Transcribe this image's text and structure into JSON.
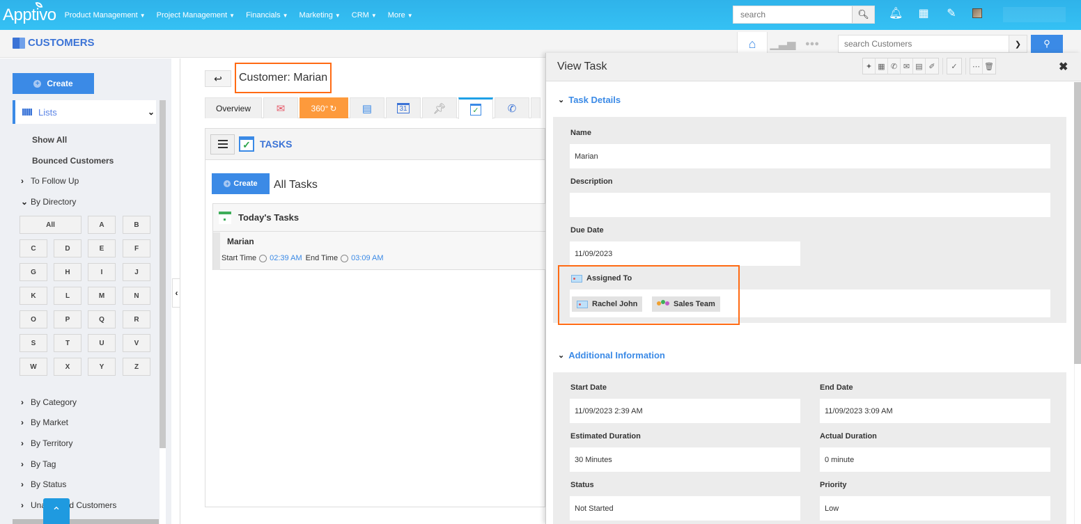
{
  "topbar": {
    "logo": "Apptivo",
    "menu": [
      {
        "label": "Product Management"
      },
      {
        "label": "Project Management"
      },
      {
        "label": "Financials"
      },
      {
        "label": "Marketing"
      },
      {
        "label": "CRM"
      },
      {
        "label": "More"
      }
    ],
    "search_placeholder": "search",
    "icons": [
      "bell-icon",
      "store-icon",
      "notes-icon",
      "avatar"
    ]
  },
  "subheader": {
    "app_title": "CUSTOMERS",
    "search_placeholder": "search Customers"
  },
  "sidebar": {
    "create_label": "Create",
    "lists_label": "Lists",
    "items": [
      {
        "label": "Show All",
        "type": "plain"
      },
      {
        "label": "Bounced Customers",
        "type": "plain"
      },
      {
        "label": "To Follow Up",
        "type": "collapsed"
      },
      {
        "label": "By Directory",
        "type": "expanded"
      },
      {
        "label": "By Category",
        "type": "collapsed"
      },
      {
        "label": "By Market",
        "type": "collapsed"
      },
      {
        "label": "By Territory",
        "type": "collapsed"
      },
      {
        "label": "By Tag",
        "type": "collapsed"
      },
      {
        "label": "By Status",
        "type": "collapsed"
      },
      {
        "label": "Unattended Customers",
        "type": "collapsed"
      }
    ],
    "directory": [
      "All",
      "A",
      "B",
      "C",
      "D",
      "E",
      "F",
      "G",
      "H",
      "I",
      "J",
      "K",
      "L",
      "M",
      "N",
      "O",
      "P",
      "Q",
      "R",
      "S",
      "T",
      "U",
      "V",
      "W",
      "X",
      "Y",
      "Z"
    ]
  },
  "main": {
    "customer_title": "Customer: Marian",
    "tabs": [
      {
        "label": "Overview",
        "icon": ""
      },
      {
        "label": "",
        "icon": "campaign-icon"
      },
      {
        "label": "360°",
        "icon": "refresh-icon"
      },
      {
        "label": "",
        "icon": "contact-card-icon"
      },
      {
        "label": "",
        "icon": "calendar-icon"
      },
      {
        "label": "",
        "icon": "pin-icon"
      },
      {
        "label": "",
        "icon": "task-icon",
        "active": true
      },
      {
        "label": "",
        "icon": "call-icon"
      }
    ],
    "tasks_title": "TASKS",
    "create_label": "Create",
    "all_tasks_label": "All Tasks",
    "today_label": "Today's Tasks",
    "task": {
      "name": "Marian",
      "start_label": "Start Time",
      "start_time": "02:39 AM",
      "end_label": "End Time",
      "end_time": "03:09 AM"
    }
  },
  "view_task": {
    "title": "View Task",
    "toolbar": [
      "pin-icon",
      "calendar-icon",
      "call-icon",
      "email-icon",
      "document-icon",
      "attachment-icon",
      "check-icon",
      "more-icon",
      "trash-icon"
    ],
    "task_details_label": "Task Details",
    "fields": {
      "name_label": "Name",
      "name_value": "Marian",
      "description_label": "Description",
      "description_value": "",
      "due_date_label": "Due Date",
      "due_date_value": "11/09/2023",
      "assigned_label": "Assigned To",
      "assignees": [
        {
          "name": "Rachel John",
          "type": "employee"
        },
        {
          "name": "Sales Team",
          "type": "team"
        }
      ]
    },
    "additional_label": "Additional Information",
    "additional": {
      "start_date_label": "Start Date",
      "start_date_value": "11/09/2023 2:39 AM",
      "end_date_label": "End Date",
      "end_date_value": "11/09/2023 3:09 AM",
      "est_duration_label": "Estimated Duration",
      "est_duration_value": "30 Minutes",
      "actual_duration_label": "Actual Duration",
      "actual_duration_value": "0 minute",
      "status_label": "Status",
      "status_value": "Not Started",
      "priority_label": "Priority",
      "priority_value": "Low"
    }
  },
  "colors": {
    "topbar": "#35c1f4",
    "primary": "#3b8ae6",
    "highlight": "#ff6a13",
    "tab_360": "#fd9a3c"
  }
}
